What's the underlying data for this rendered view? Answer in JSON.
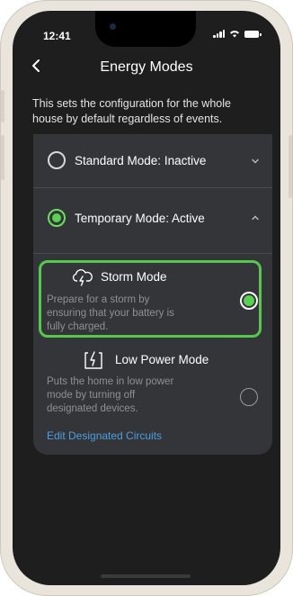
{
  "status_bar": {
    "time": "12:41"
  },
  "nav": {
    "title": "Energy Modes",
    "back_icon": "chevron-left-icon"
  },
  "intro_text": "This sets the configuration for the whole house by default regardless of events.",
  "modes": {
    "standard": {
      "label": "Standard Mode: Inactive",
      "selected": false,
      "expanded": false
    },
    "temporary": {
      "label": "Temporary Mode: Active",
      "selected": true,
      "expanded": true
    }
  },
  "temporary_options": [
    {
      "title": "Storm Mode",
      "description": "Prepare for a storm by ensuring that your battery is fully charged.",
      "icon": "storm-cloud-icon",
      "selected": true,
      "highlighted": true
    },
    {
      "title": "Low Power Mode",
      "description": "Puts the home in low power mode by turning off designated devices.",
      "icon": "low-power-icon",
      "selected": false,
      "link": "Edit Designated Circuits"
    }
  ],
  "colors": {
    "background": "#1e1e1f",
    "card": "#343539",
    "accent_green": "#5bd153",
    "highlight_border": "#55c94d",
    "link_blue": "#4b9fe0",
    "muted_text": "#8f8f95"
  }
}
